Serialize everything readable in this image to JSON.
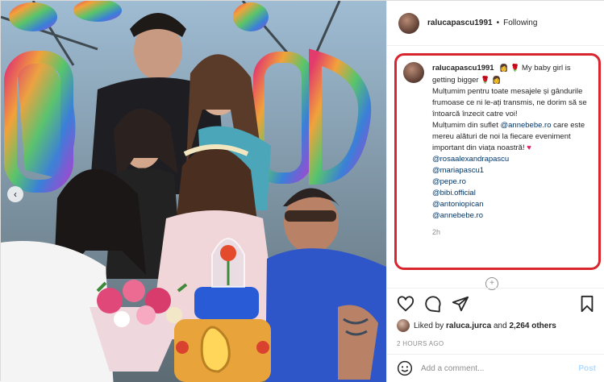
{
  "post": {
    "username": "ralucapascu1991",
    "follow_status": "Following",
    "separator": "•"
  },
  "caption": {
    "username": "ralucapascu1991",
    "lines": [
      "My baby girl is getting bigger",
      "Mulțumim pentru toate mesajele și gândurile frumoase ce ni le-ați transmis, ne dorim să se întoarcă înzecit catre voi!",
      "Mulțumim din suflet",
      "care este mereu alături de noi la fiecare eveniment important din viața noastră!"
    ],
    "inline_mention": "@annebebe.ro",
    "mentions": [
      "@rosaalexandrapascu",
      "@mariapascu1",
      "@pepe.ro",
      "@bibi.official",
      "@antoniopican",
      "@annebebe.ro"
    ],
    "time": "2h"
  },
  "likes": {
    "prefix": "Liked by",
    "user": "raluca.jurca",
    "joiner": "and",
    "others": "2,264 others"
  },
  "posted_ago": "2 HOURS AGO",
  "comment": {
    "placeholder": "Add a comment...",
    "post_label": "Post"
  },
  "colors": {
    "highlight_border": "#d9262e",
    "link": "#00376b",
    "post_disabled": "#b3dbff"
  }
}
